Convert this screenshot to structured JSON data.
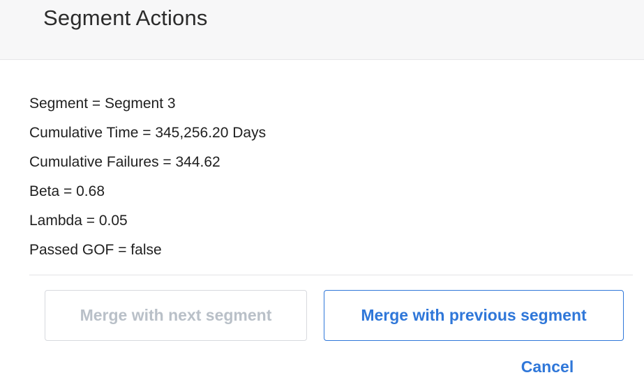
{
  "dialog": {
    "title": "Segment Actions"
  },
  "details": [
    "Segment = Segment 3",
    "Cumulative Time = 345,256.20 Days",
    "Cumulative Failures = 344.62",
    "Beta = 0.68",
    "Lambda = 0.05",
    "Passed GOF = false"
  ],
  "buttons": {
    "merge_next_label": "Merge with next segment",
    "merge_next_enabled": false,
    "merge_previous_label": "Merge with previous segment",
    "cancel_label": "Cancel"
  },
  "colors": {
    "accent": "#2f77d9",
    "disabled_text": "#b9c0c8",
    "header_background": "#f7f7f8"
  }
}
